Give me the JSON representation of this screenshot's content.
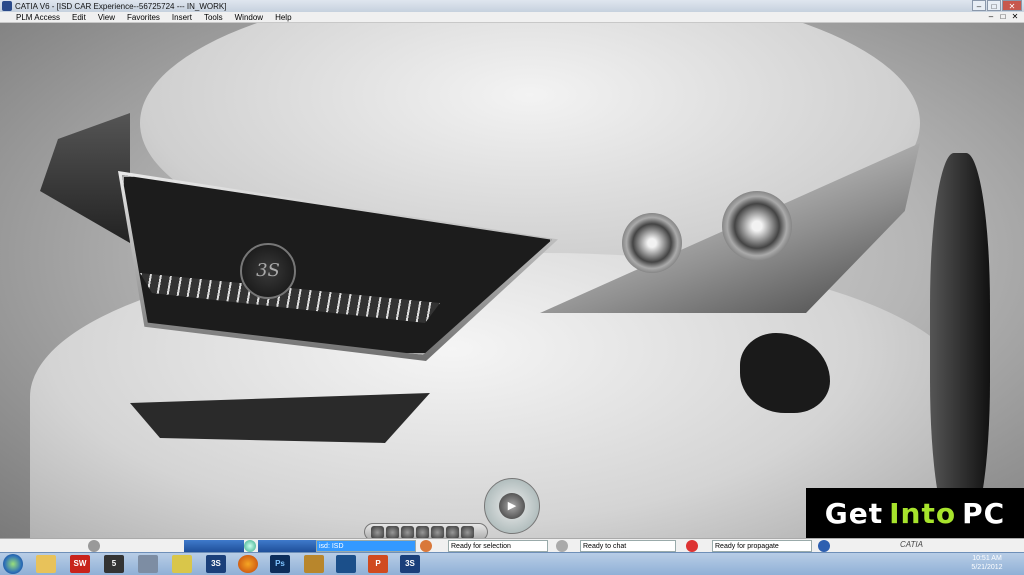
{
  "window": {
    "title": "CATIA V6 - [ISD CAR Experience--56725724 --- IN_WORK]",
    "controls": [
      "–",
      "□",
      "✕"
    ]
  },
  "menu": {
    "items": [
      "PLM Access",
      "Edit",
      "View",
      "Favorites",
      "Insert",
      "Tools",
      "Window",
      "Help"
    ]
  },
  "viewport": {
    "logo_glyph": "3S"
  },
  "status": {
    "field_selected": "isd: ISD",
    "selection": "Ready for selection",
    "chat": "Ready to chat",
    "propagate": "Ready for propagate",
    "brand": "CATIA"
  },
  "watermark": {
    "part1": "Get",
    "part2": "Into",
    "part3": "PC"
  },
  "taskbar": {
    "icons": [
      "explorer-icon",
      "solidworks-icon",
      "catia-icon",
      "tools-icon",
      "lightbulb-icon",
      "ds-icon",
      "firefox-icon",
      "photoshop-icon",
      "media-icon",
      "image-icon",
      "powerpoint-icon",
      "ds-icon-2"
    ],
    "time": "10:51 AM",
    "date": "5/21/2012"
  },
  "colors": {
    "accent_green": "#a7e32c",
    "taskbar": "#8fb0d6",
    "status_blue": "#1f4f9a"
  }
}
